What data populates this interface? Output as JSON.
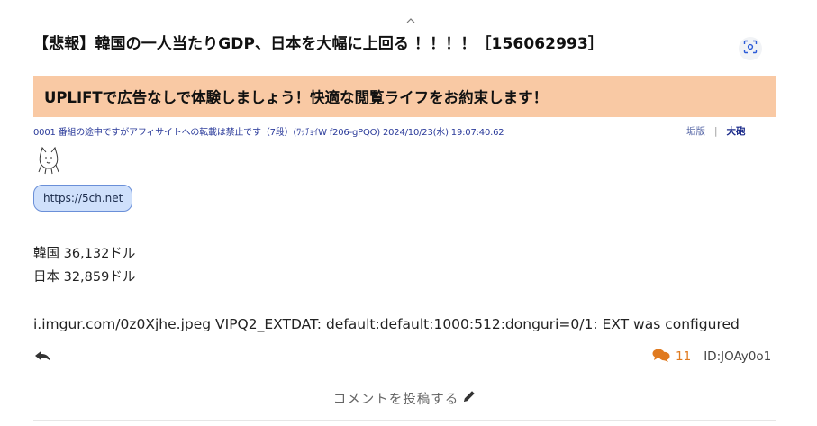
{
  "thread": {
    "title": "【悲報】韓国の一人当たりGDP、日本を大幅に上回る ！！！！［156062993］"
  },
  "ad_banner": {
    "text": "UPLIFTで広告なしで体験しましょう！快適な閲覧ライフをお約束します！",
    "background": "#f9c9a4"
  },
  "post": {
    "meta": "0001 番組の途中ですがアフィサイトへの転載は禁止です（7段）(ﾜｯﾁｮｲW f206-gPQO) 2024/10/23(水) 19:07:40.62",
    "actions": {
      "action_1": "垢版",
      "separator": "|",
      "action_2": "大砲"
    },
    "link_pill": "https://5ch.net",
    "body_lines": [
      "韓国 36,132ドル",
      "日本 32,859ドル"
    ],
    "imgur_line": "i.imgur.com/0z0Xjhe.jpeg VIPQ2_EXTDAT: default:default:1000:512:donguri=0/1: EXT was configured",
    "reply_count": "11",
    "post_id": "ID:JOAy0o1"
  },
  "comment_button": {
    "label": "コメントを投稿する"
  },
  "colors": {
    "accent_orange": "#e07a1f",
    "meta_blue": "#2a3a9a",
    "pill_bg": "#cfe0fb",
    "pill_border": "#6a8fd8"
  },
  "icons": {
    "scan": "scan-lens-icon",
    "aa": "ascii-art-icon",
    "reply": "reply-arrow-icon",
    "speech": "speech-bubbles-icon",
    "pencil": "pencil-icon"
  }
}
